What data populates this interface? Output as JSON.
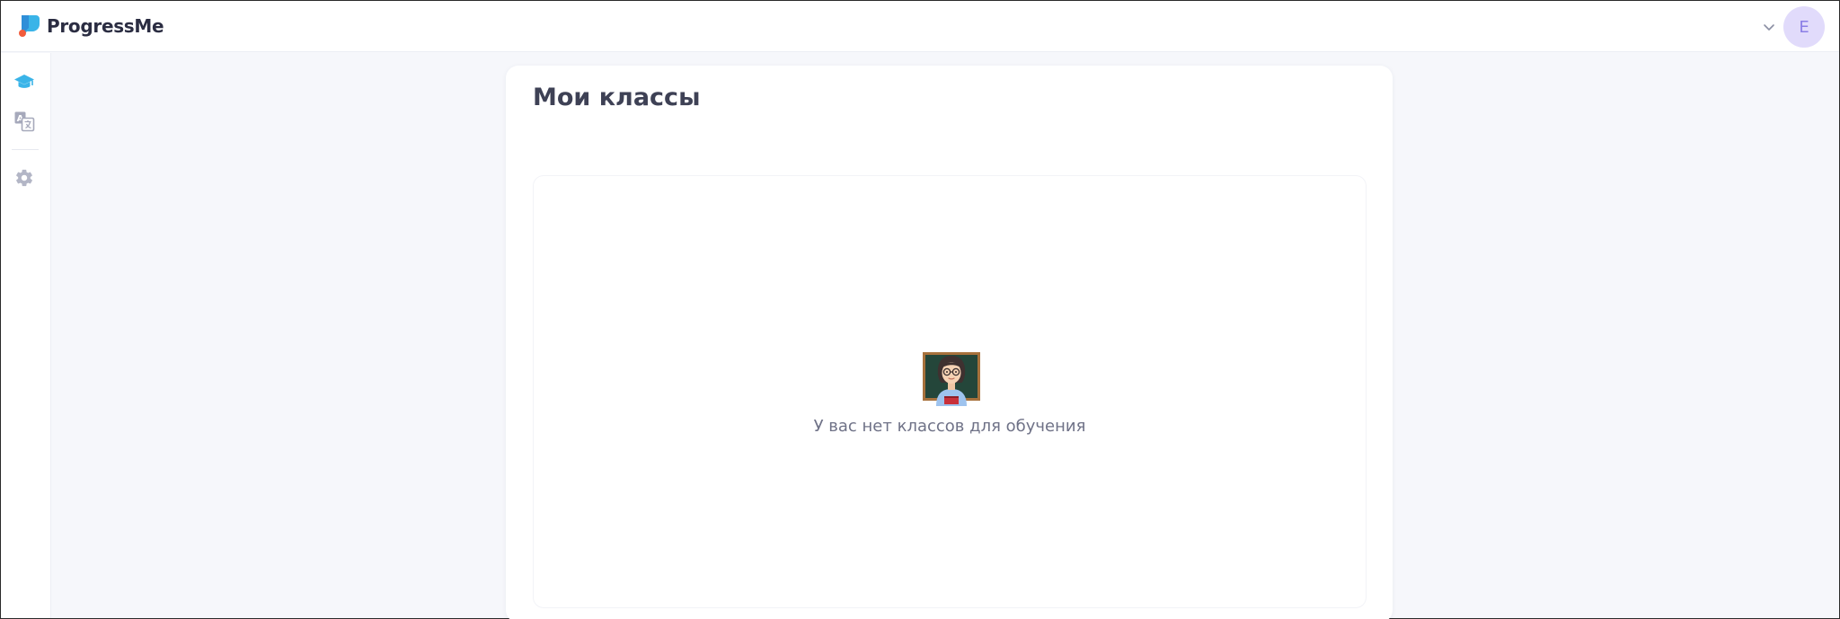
{
  "app": {
    "name": "ProgressMe"
  },
  "header": {
    "avatar_initial": "E",
    "menu_icon": "chevron-down-icon"
  },
  "sidebar": {
    "items": [
      {
        "name": "classes",
        "icon": "graduation-cap-icon",
        "active": true
      },
      {
        "name": "dictionary",
        "icon": "translate-icon",
        "active": false
      },
      {
        "name": "settings",
        "icon": "gear-icon",
        "active": false
      }
    ]
  },
  "main": {
    "title": "Мои классы",
    "empty_state": {
      "icon": "teacher-emoji-icon",
      "message": "У вас нет классов для обучения"
    }
  },
  "colors": {
    "accent": "#3ab4e8",
    "avatar_bg": "#e1dbfb",
    "avatar_text": "#8b7ee6",
    "background": "#f6f7fb"
  }
}
